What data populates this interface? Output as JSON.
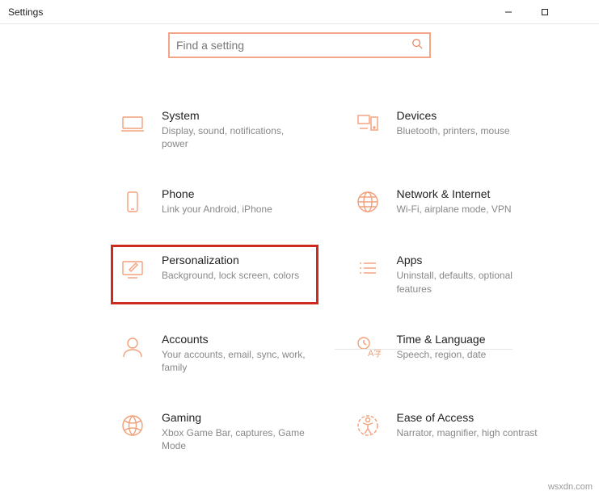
{
  "window": {
    "title": "Settings"
  },
  "search": {
    "placeholder": "Find a setting"
  },
  "tiles": {
    "system": {
      "title": "System",
      "desc": "Display, sound, notifications, power"
    },
    "devices": {
      "title": "Devices",
      "desc": "Bluetooth, printers, mouse"
    },
    "phone": {
      "title": "Phone",
      "desc": "Link your Android, iPhone"
    },
    "network": {
      "title": "Network & Internet",
      "desc": "Wi-Fi, airplane mode, VPN"
    },
    "personalization": {
      "title": "Personalization",
      "desc": "Background, lock screen, colors"
    },
    "apps": {
      "title": "Apps",
      "desc": "Uninstall, defaults, optional features"
    },
    "accounts": {
      "title": "Accounts",
      "desc": "Your accounts, email, sync, work, family"
    },
    "time": {
      "title": "Time & Language",
      "desc": "Speech, region, date"
    },
    "gaming": {
      "title": "Gaming",
      "desc": "Xbox Game Bar, captures, Game Mode"
    },
    "ease": {
      "title": "Ease of Access",
      "desc": "Narrator, magnifier, high contrast"
    }
  },
  "watermark": "wsxdn.com"
}
